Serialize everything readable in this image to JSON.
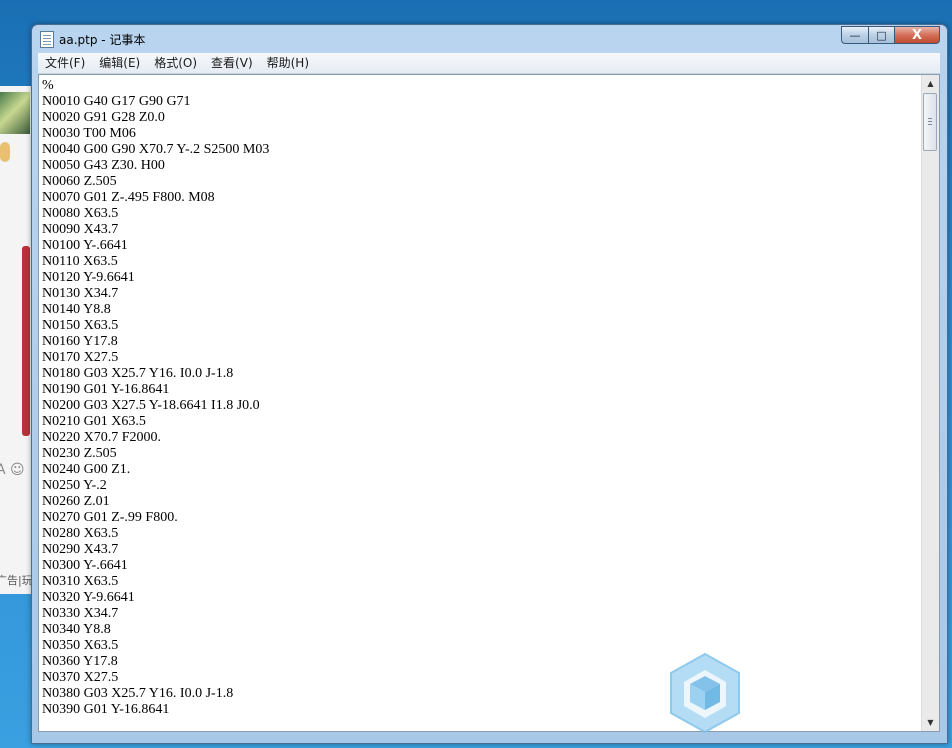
{
  "window": {
    "title": "aa.ptp - 记事本",
    "minimize_glyph": "—",
    "maximize_glyph": "□",
    "close_glyph": "X"
  },
  "menu": [
    {
      "label": "文件(F)"
    },
    {
      "label": "编辑(E)"
    },
    {
      "label": "格式(O)"
    },
    {
      "label": "查看(V)"
    },
    {
      "label": "帮助(H)"
    }
  ],
  "editor": {
    "lines": [
      "%",
      "N0010 G40 G17 G90 G71",
      "N0020 G91 G28 Z0.0",
      "N0030 T00 M06",
      "N0040 G00 G90 X70.7 Y-.2 S2500 M03",
      "N0050 G43 Z30. H00",
      "N0060 Z.505",
      "N0070 G01 Z-.495 F800. M08",
      "N0080 X63.5",
      "N0090 X43.7",
      "N0100 Y-.6641",
      "N0110 X63.5",
      "N0120 Y-9.6641",
      "N0130 X34.7",
      "N0140 Y8.8",
      "N0150 X63.5",
      "N0160 Y17.8",
      "N0170 X27.5",
      "N0180 G03 X25.7 Y16. I0.0 J-1.8",
      "N0190 G01 Y-16.8641",
      "N0200 G03 X27.5 Y-18.6641 I1.8 J0.0",
      "N0210 G01 X63.5",
      "N0220 X70.7 F2000.",
      "N0230 Z.505",
      "N0240 G00 Z1.",
      "N0250 Y-.2",
      "N0260 Z.01",
      "N0270 G01 Z-.99 F800.",
      "N0280 X63.5",
      "N0290 X43.7",
      "N0300 Y-.6641",
      "N0310 X63.5",
      "N0320 Y-9.6641",
      "N0330 X34.7",
      "N0340 Y8.8",
      "N0350 X63.5",
      "N0360 Y17.8",
      "N0370 X27.5",
      "N0380 G03 X25.7 Y16. I0.0 J-1.8",
      "N0390 G01 Y-16.8641"
    ]
  },
  "background_app": {
    "visible_text_1": "A ☺",
    "visible_text_2": "广告|玩"
  },
  "colors": {
    "title_gradient_top": "#b9d4ee",
    "close_button": "#c04a30",
    "editor_bg": "#ffffff"
  }
}
